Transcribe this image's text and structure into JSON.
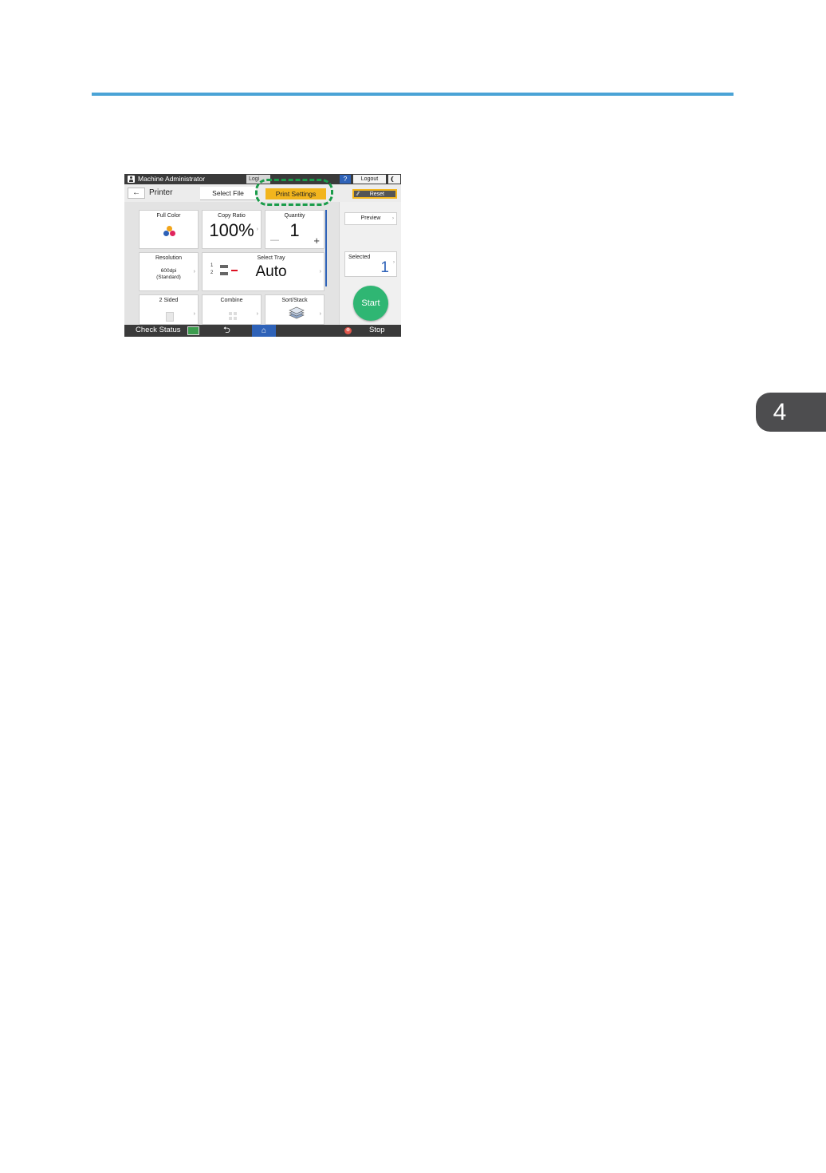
{
  "page": {
    "chapter_number": "4",
    "colors": {
      "rule": "#4aa3d6",
      "chapter_tab": "#4d4d4f",
      "highlight": "#1a9c4a"
    }
  },
  "panel": {
    "status_bar": {
      "user_name": "Machine Administrator",
      "login_stub": "Logi",
      "help_label": "?",
      "logout_label": "Logout",
      "sleep_icon": "moon-icon"
    },
    "header": {
      "back_icon": "←",
      "app_title": "Printer",
      "tabs": {
        "select_file": "Select File",
        "print_settings": "Print Settings"
      },
      "reset_label": "Reset"
    },
    "tiles": {
      "full_color": {
        "label": "Full Color"
      },
      "copy_ratio": {
        "label": "Copy Ratio",
        "value": "100%"
      },
      "quantity": {
        "label": "Quantity",
        "value": "1",
        "minus": "—",
        "plus": "+"
      },
      "resolution": {
        "label": "Resolution",
        "value_line1": "600dpi",
        "value_line2": "(Standard)"
      },
      "select_tray": {
        "label": "Select Tray",
        "value": "Auto",
        "tray_1": "1",
        "tray_2": "2"
      },
      "two_sided": {
        "label": "2 Sided"
      },
      "combine": {
        "label": "Combine"
      },
      "sort_stack": {
        "label": "Sort/Stack"
      }
    },
    "right": {
      "preview_label": "Preview",
      "selected_label": "Selected",
      "selected_count": "1",
      "start_label": "Start"
    },
    "bottom_bar": {
      "check_status": "Check Status",
      "back_glyph": "⮌",
      "home_glyph": "⌂",
      "stop_glyph": "⊗",
      "stop_label": "Stop"
    },
    "colors": {
      "accent_tab": "#f2b51d",
      "start": "#2fb673",
      "blue": "#2e62b8"
    }
  }
}
